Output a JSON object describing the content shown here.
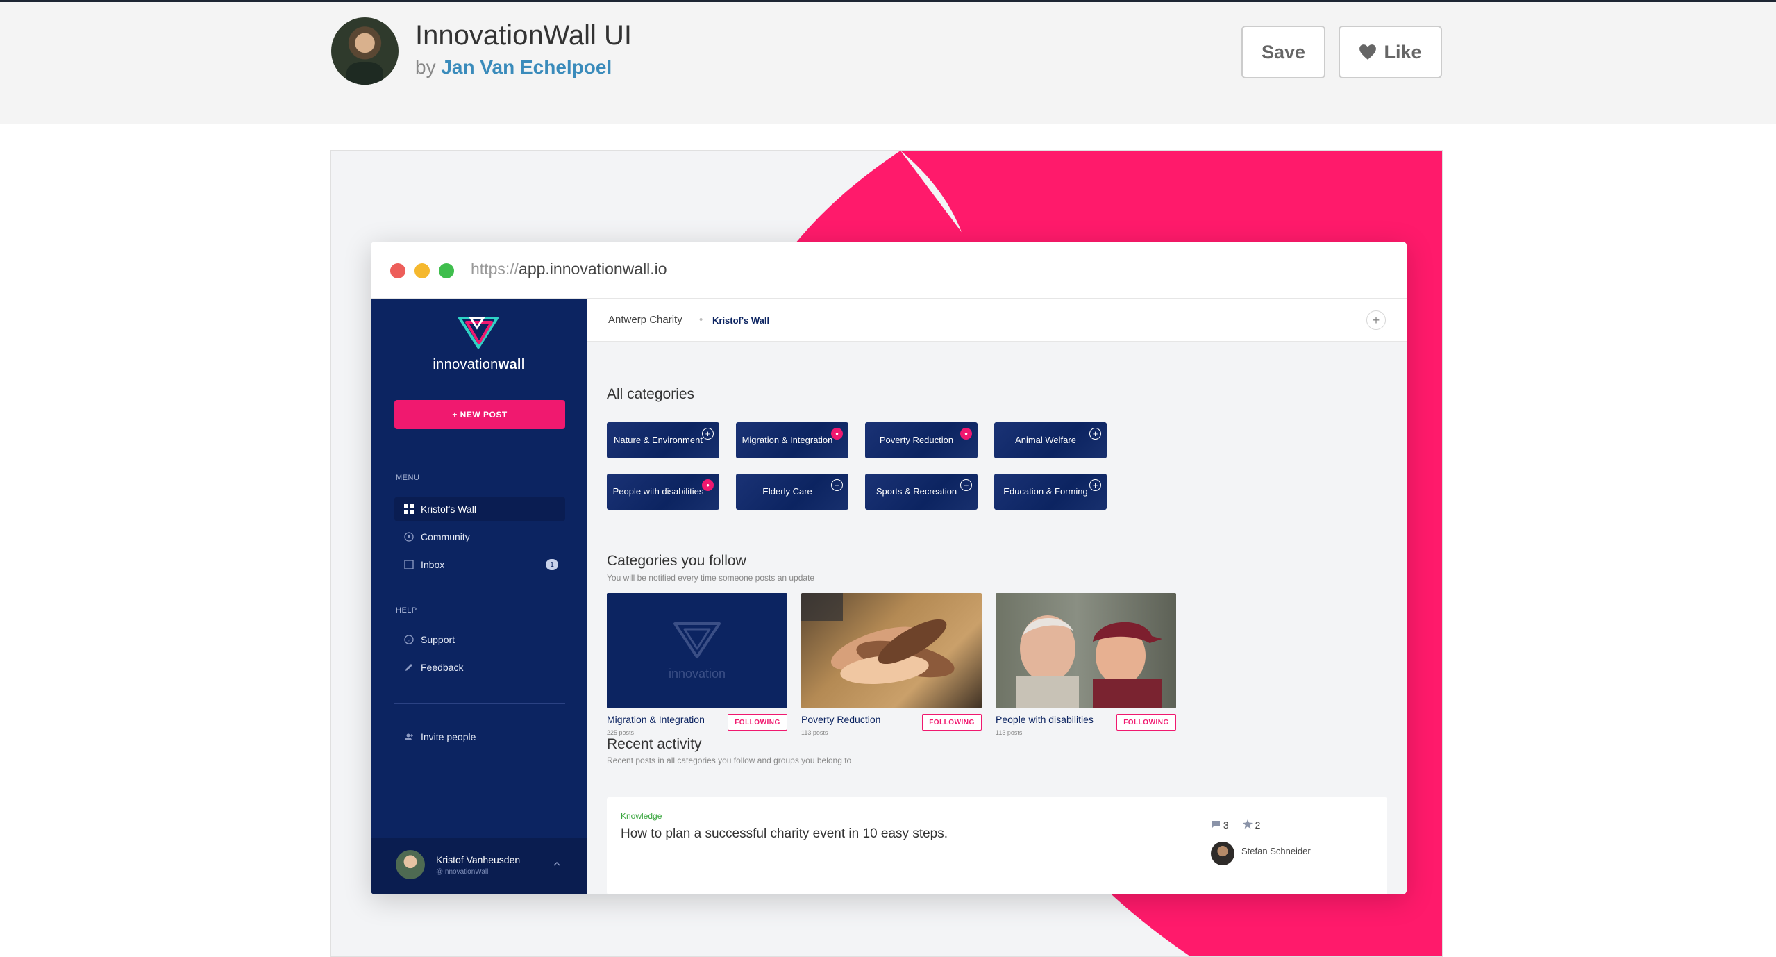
{
  "header": {
    "title": "InnovationWall UI",
    "by_prefix": "by",
    "author": "Jan Van Echelpoel",
    "save_label": "Save",
    "like_label": "Like"
  },
  "colors": {
    "accent": "#f0196f",
    "navy": "#0c2461",
    "link": "#3a8bbb"
  },
  "browser": {
    "protocol": "https://",
    "host": "app.innovationwall.io"
  },
  "sidebar": {
    "logo_light": "innovation",
    "logo_bold": "wall",
    "new_post": "+ NEW POST",
    "menu_label": "MENU",
    "menu_items": [
      {
        "label": "Kristof's Wall",
        "icon": "grid-icon"
      },
      {
        "label": "Community",
        "icon": "community-icon"
      },
      {
        "label": "Inbox",
        "icon": "inbox-icon",
        "badge": "1"
      }
    ],
    "help_label": "HELP",
    "help_items": [
      {
        "label": "Support",
        "icon": "help-circle-icon"
      },
      {
        "label": "Feedback",
        "icon": "pencil-icon"
      }
    ],
    "invite": "Invite people",
    "user": {
      "name": "Kristof Vanheusden",
      "handle": "@InnovationWall"
    }
  },
  "breadcrumb": {
    "org": "Antwerp Charity",
    "wall": "Kristof's Wall"
  },
  "all_categories": {
    "heading": "All categories",
    "items": [
      {
        "label": "Nature & Environment",
        "state": "add"
      },
      {
        "label": "Migration & Integration",
        "state": "followed"
      },
      {
        "label": "Poverty Reduction",
        "state": "followed"
      },
      {
        "label": "Animal Welfare",
        "state": "add"
      },
      {
        "label": "People with disabilities",
        "state": "followed"
      },
      {
        "label": "Elderly Care",
        "state": "add"
      },
      {
        "label": "Sports & Recreation",
        "state": "add"
      },
      {
        "label": "Education & Forming",
        "state": "add"
      }
    ]
  },
  "follow": {
    "heading": "Categories you follow",
    "subheading": "You will be notified every time someone posts an update",
    "following_label": "FOLLOWING",
    "cards": [
      {
        "name": "Migration & Integration",
        "count": "225 posts",
        "image": "innovationwall-logo"
      },
      {
        "name": "Poverty Reduction",
        "count": "113 posts",
        "image": "stacked-hands-photo"
      },
      {
        "name": "People with disabilities",
        "count": "113 posts",
        "image": "two-men-laughing-photo"
      }
    ]
  },
  "recent": {
    "heading": "Recent activity",
    "subheading": "Recent posts in all categories you follow and groups you belong to",
    "post": {
      "tag": "Knowledge",
      "title": "How to plan a successful charity event in 10 easy steps.",
      "comments": "3",
      "stars": "2",
      "author": "Stefan Schneider"
    }
  }
}
